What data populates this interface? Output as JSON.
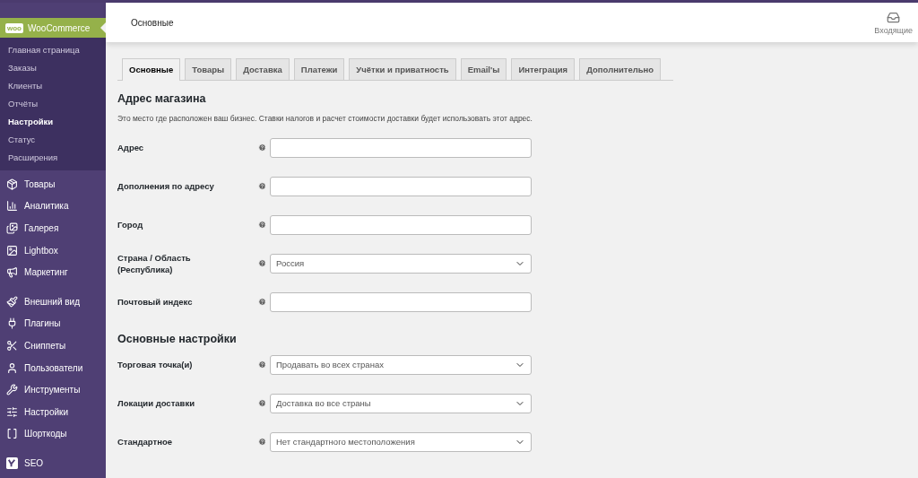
{
  "sidebar": {
    "current": {
      "label": "WooCommerce",
      "badge": "woo",
      "selected": true
    },
    "submenu": [
      {
        "label": "Главная страница",
        "selected": false
      },
      {
        "label": "Заказы",
        "selected": false
      },
      {
        "label": "Клиенты",
        "selected": false
      },
      {
        "label": "Отчёты",
        "selected": false
      },
      {
        "label": "Настройки",
        "selected": true
      },
      {
        "label": "Статус",
        "selected": false
      },
      {
        "label": "Расширения",
        "selected": false
      }
    ],
    "groups": [
      [
        {
          "label": "Товары"
        },
        {
          "label": "Аналитика"
        },
        {
          "label": "Галерея"
        },
        {
          "label": "Lightbox"
        },
        {
          "label": "Маркетинг"
        }
      ],
      [
        {
          "label": "Внешний вид"
        },
        {
          "label": "Плагины"
        },
        {
          "label": "Сниппеты"
        },
        {
          "label": "Пользователи"
        },
        {
          "label": "Инструменты"
        },
        {
          "label": "Настройки"
        },
        {
          "label": "Шорткоды"
        }
      ],
      [
        {
          "label": "SEO"
        }
      ]
    ]
  },
  "header": {
    "title": "Основные",
    "inbox": "Входящие"
  },
  "tabs": [
    {
      "label": "Основные",
      "selected": true
    },
    {
      "label": "Товары",
      "selected": false
    },
    {
      "label": "Доставка",
      "selected": false
    },
    {
      "label": "Платежи",
      "selected": false
    },
    {
      "label": "Учётки и приватность",
      "selected": false
    },
    {
      "label": "Email'ы",
      "selected": false
    },
    {
      "label": "Интеграция",
      "selected": false
    },
    {
      "label": "Дополнительно",
      "selected": false
    }
  ],
  "sections": [
    {
      "heading": "Адрес магазина",
      "description": "Это место где расположен ваш бизнес. Ставки налогов и расчет стоимости доставки будет использовать этот адрес.",
      "fields": [
        {
          "label": "Адрес",
          "kind": "input"
        },
        {
          "label": "Дополнения по адресу",
          "kind": "input"
        },
        {
          "label": "Город",
          "kind": "input"
        },
        {
          "label": "Страна / Область (Республика)",
          "kind": "select",
          "value": "Россия"
        },
        {
          "label": "Почтовый индекс",
          "kind": "input"
        }
      ]
    },
    {
      "heading": "Основные настройки",
      "fields": [
        {
          "label": "Торговая точка(и)",
          "kind": "select",
          "value": "Продавать во всех странах"
        },
        {
          "label": "Локации доставки",
          "kind": "select",
          "value": "Доставка во все страны"
        },
        {
          "label": "Стандартное",
          "kind": "select",
          "value": "Нет стандартного местоположения"
        }
      ]
    }
  ]
}
